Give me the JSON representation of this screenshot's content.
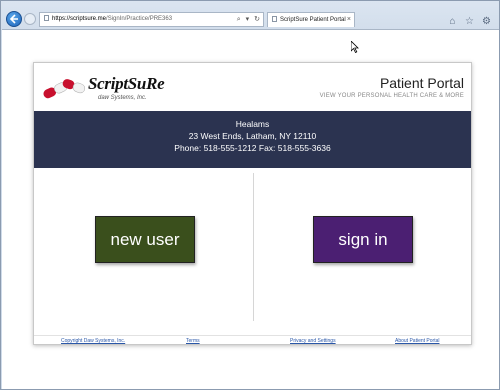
{
  "browser": {
    "url_host": "https://scriptsure.me",
    "url_path": "/SignIn/Practice/PRE363",
    "address_tools": [
      "⌕",
      "▾",
      "↻"
    ],
    "tab_label": "ScriptSure Patient Portal",
    "tab_close": "×",
    "window_icons": [
      "⌂",
      "☆",
      "⚙"
    ]
  },
  "header": {
    "logo_text": "ScriptSuRe",
    "logo_sub": "daw Systems, Inc.",
    "title": "Patient Portal",
    "tagline": "VIEW YOUR PERSONAL HEALTH CARE & MORE"
  },
  "practice": {
    "name": "Healams",
    "address": "23 West Ends, Latham, NY 12110",
    "contact": "Phone: 518-555-1212 Fax: 518-555-3636"
  },
  "actions": {
    "new_user": "new user",
    "sign_in": "sign in"
  },
  "footer": {
    "copyright": "Copyright Daw Systems, Inc.",
    "terms": "Terms",
    "privacy": "Privacy and Settings",
    "about": "About Patient Portal"
  },
  "colors": {
    "banner": "#2b3350",
    "new_user_button": "#3a4f1c",
    "sign_in_button": "#4b1f72"
  }
}
